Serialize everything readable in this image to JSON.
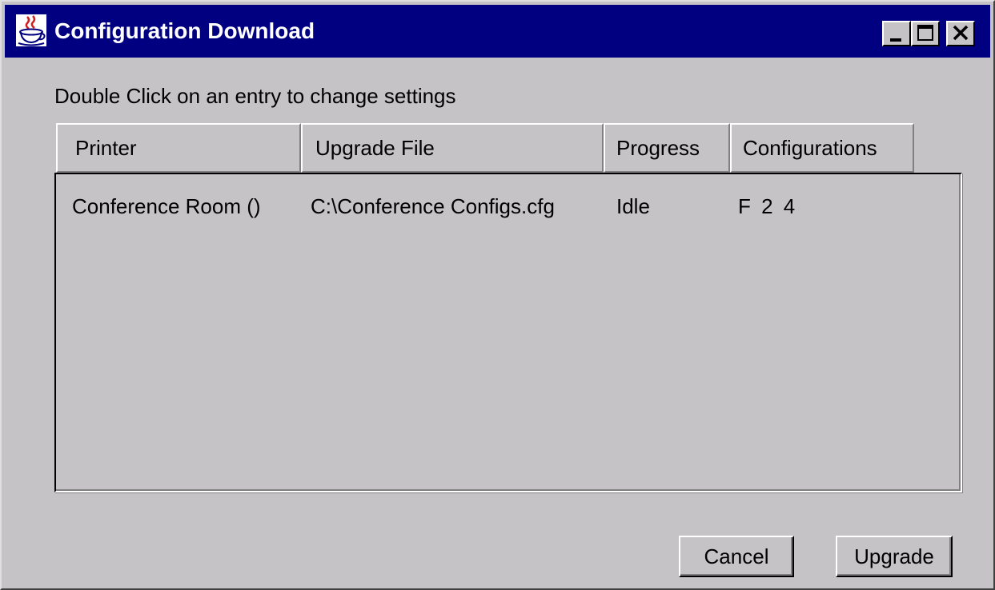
{
  "window": {
    "title": "Configuration Download",
    "icon": "java-cup-icon",
    "controls": [
      "minimize",
      "maximize",
      "close"
    ]
  },
  "instruction": "Double Click on an entry to change settings",
  "table": {
    "columns": [
      "Printer",
      "Upgrade File",
      "Progress",
      "Configurations"
    ],
    "rows": [
      {
        "printer": "Conference Room ()",
        "upgrade_file": "C:\\Conference Configs.cfg",
        "progress": "Idle",
        "configurations": "F 2 4"
      }
    ]
  },
  "buttons": {
    "cancel": "Cancel",
    "upgrade": "Upgrade"
  },
  "colors": {
    "titlebar": "#000080",
    "face": "#c6c3c6",
    "title_text": "#ffffff"
  }
}
